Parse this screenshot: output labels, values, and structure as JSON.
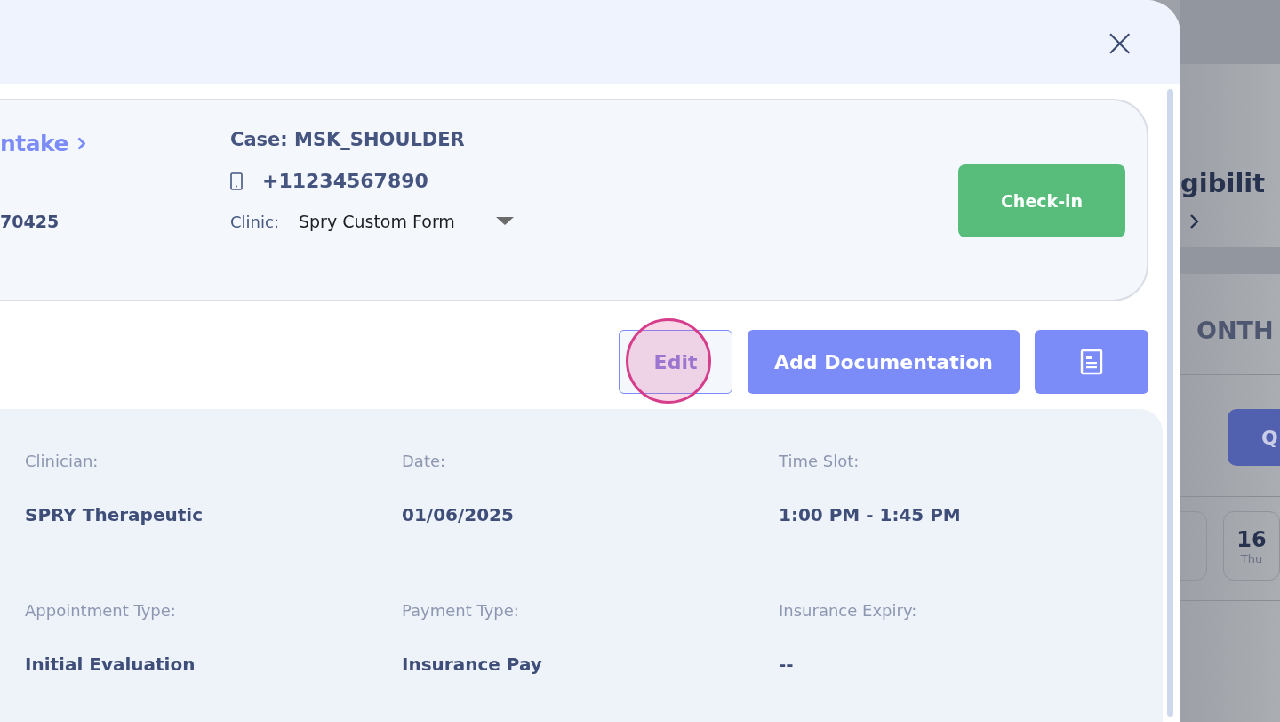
{
  "modal": {
    "header": {
      "close_label": "×"
    },
    "summary": {
      "title": "ntake",
      "id_text": "70425",
      "case": "Case: MSK_SHOULDER",
      "phone": "+11234567890",
      "clinic_label": "Clinic:",
      "clinic_value": "Spry Custom Form",
      "checkin": "Check-in"
    },
    "actions": [
      {
        "kind": "outline",
        "label": "Edit",
        "highlighted": true
      },
      {
        "kind": "primary",
        "label": "Add Documentation",
        "highlighted": false
      },
      {
        "kind": "icon",
        "highlighted": false
      }
    ],
    "details": [
      {
        "label": "Clinician:",
        "value": "SPRY Therapeutic"
      },
      {
        "label": "Date:",
        "value": "01/06/2025"
      },
      {
        "label": "Time Slot:",
        "value": "1:00 PM - 1:45 PM"
      },
      {
        "label": "Appointment Type:",
        "value": "Initial Evaluation"
      },
      {
        "label": "Payment Type:",
        "value": "Insurance Pay"
      },
      {
        "label": "Insurance Expiry:",
        "value": "--"
      }
    ]
  },
  "background_page": {
    "title": "gibilit",
    "tab": "ONTH",
    "button": "Q",
    "date_cards": [
      {
        "day": "16",
        "weekday": "Thu"
      }
    ]
  }
}
